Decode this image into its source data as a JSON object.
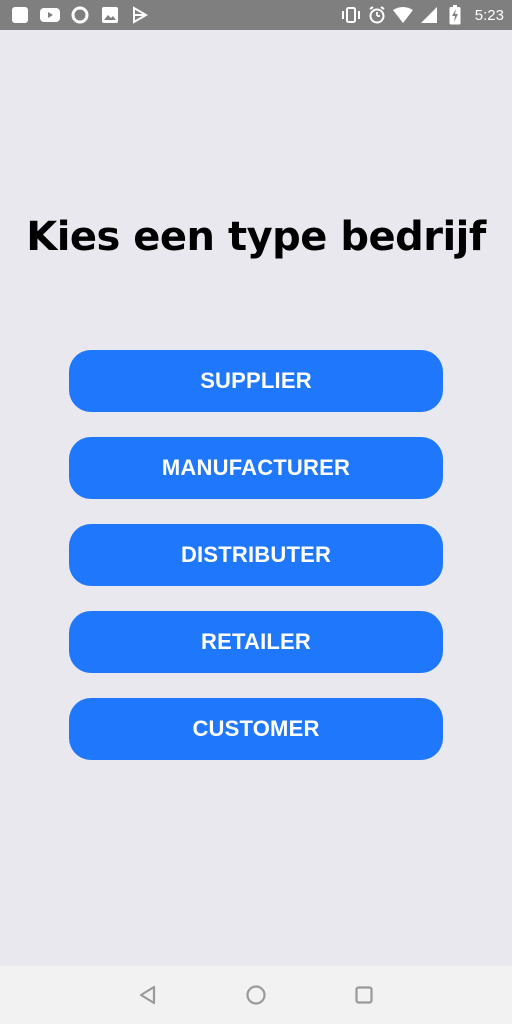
{
  "status_bar": {
    "time": "5:23",
    "left_icons": [
      "notification-icon",
      "youtube-icon",
      "circle-icon",
      "image-icon",
      "play-store-icon"
    ],
    "right_icons": [
      "vibrate-icon",
      "alarm-icon",
      "wifi-icon",
      "signal-icon",
      "battery-icon"
    ],
    "background_color": "#7f7f7f"
  },
  "page": {
    "title": "Kies een type bedrijf",
    "background_color": "#e9e8ee"
  },
  "buttons": [
    {
      "label": "SUPPLIER"
    },
    {
      "label": "MANUFACTURER"
    },
    {
      "label": "DISTRIBUTER"
    },
    {
      "label": "RETAILER"
    },
    {
      "label": "CUSTOMER"
    }
  ],
  "button_color": "#1f78fc",
  "nav_bar": {
    "icons": [
      "back-icon",
      "home-icon",
      "recents-icon"
    ]
  }
}
